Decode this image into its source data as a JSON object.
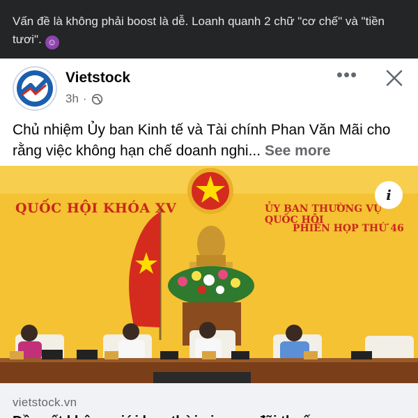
{
  "comment": {
    "text": "Vấn đề là không phải boost là dễ. Loanh quanh 2 chữ \"cơ chế\" và \"tiền tươi\".",
    "emoji_icon": "smiling-devil-emoji-icon"
  },
  "post": {
    "page_name": "Vietstock",
    "time": "3h",
    "separator": "·",
    "audience_icon": "globe-icon",
    "more_icon": "more-options-icon",
    "close_icon": "close-icon",
    "text": "Chủ nhiệm Ủy ban Kinh tế và Tài chính Phan Văn Mãi cho rằng việc không hạn chế doanh nghi...",
    "see_more_label": "See more",
    "image": {
      "banner_left": "QUỐC HỘI KHÓA XV",
      "banner_right_line1": "ỦY BAN THƯỜNG VỤ QUỐC HỘI",
      "banner_right_line2": "PHIÊN HỌP THỨ 46",
      "info_label": "i"
    },
    "link": {
      "domain": "vietstock.vn",
      "title": "Đề xuất không giới hạn thời gian ưu đãi thuế"
    }
  },
  "colors": {
    "dark_bar": "#242526",
    "brand_blue": "#1b5fb0",
    "backdrop_yellow": "#f4c233",
    "flag_red": "#d52b1e",
    "flag_star": "#ffde00",
    "muted_text": "#65676b"
  }
}
